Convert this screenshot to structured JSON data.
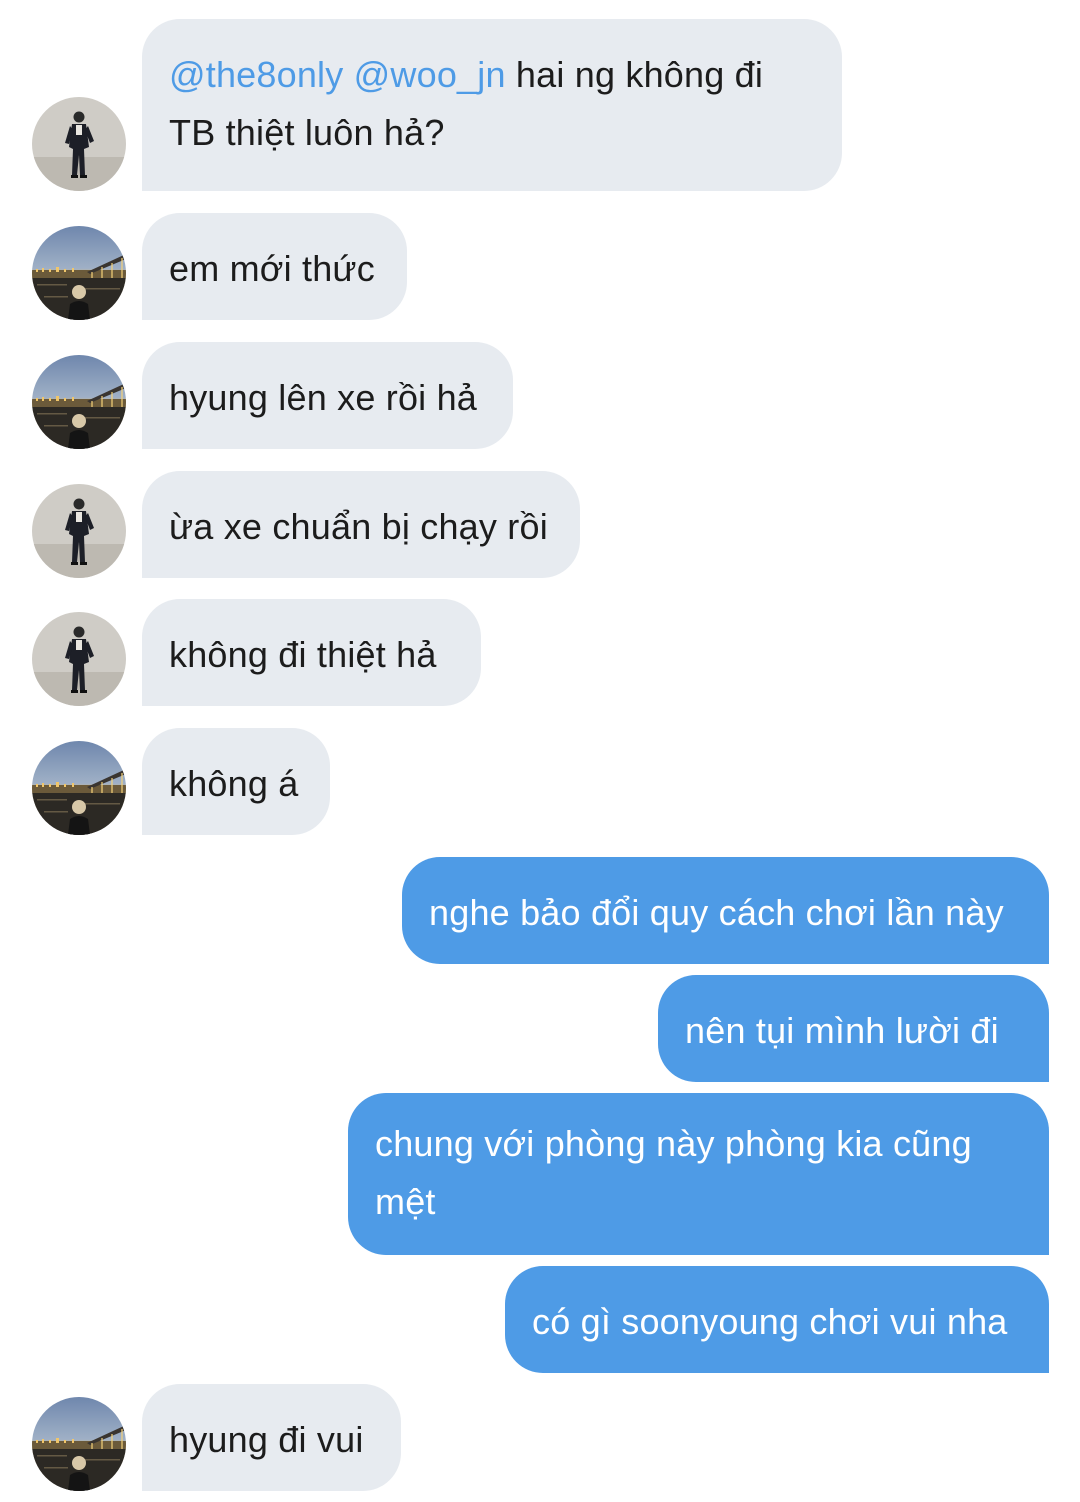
{
  "colors": {
    "incoming_bubble": "#e7ebf0",
    "outgoing_bubble": "#4e9be6",
    "mention": "#4e9be6"
  },
  "avatars": {
    "a": "avatar-standing-person-in-suit",
    "b": "avatar-night-city-bridge-portrait"
  },
  "messages": [
    {
      "side": "in",
      "avatar": "a",
      "mentions": [
        "@the8only",
        "@woo_jn"
      ],
      "text_line1_rest": " hai ng không đi",
      "text_line2": "TB thiệt luôn hả?"
    },
    {
      "side": "in",
      "avatar": "b",
      "text": "em mới thức"
    },
    {
      "side": "in",
      "avatar": "b",
      "text": "hyung lên xe rồi hả"
    },
    {
      "side": "in",
      "avatar": "a",
      "text": "ừa xe chuẩn bị chạy rồi"
    },
    {
      "side": "in",
      "avatar": "a",
      "text": "không đi thiệt hả"
    },
    {
      "side": "in",
      "avatar": "b",
      "text": "không á"
    },
    {
      "side": "out",
      "text": "nghe bảo đổi quy cách chơi lần này"
    },
    {
      "side": "out",
      "text": "nên tụi mình lười đi"
    },
    {
      "side": "out",
      "text_line1": "chung với phòng này phòng kia cũng",
      "text_line2": "mệt"
    },
    {
      "side": "out",
      "text": "có gì soonyoung chơi vui nha"
    },
    {
      "side": "in",
      "avatar": "b",
      "text": "hyung đi vui"
    }
  ]
}
